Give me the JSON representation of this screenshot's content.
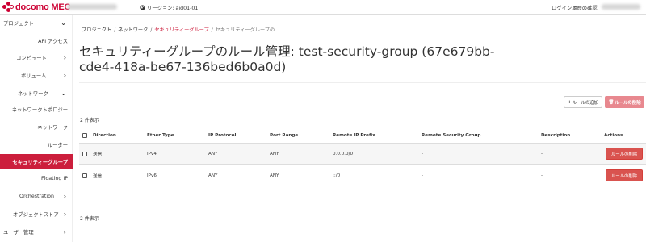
{
  "header": {
    "logo_text": "docomo MEC",
    "region_label": "リージョン: aid01-01",
    "login_history": "ログイン履歴の確認",
    "brand_color": "#cc0033"
  },
  "sidebar": {
    "items": [
      {
        "label": "プロジェクト"
      },
      {
        "label": "API アクセス"
      },
      {
        "label": "コンピュート"
      },
      {
        "label": "ボリューム"
      },
      {
        "label": "ネットワーク"
      },
      {
        "label": "ネットワークトポロジー"
      },
      {
        "label": "ネットワーク"
      },
      {
        "label": "ルーター"
      },
      {
        "label": "セキュリティーグループ"
      },
      {
        "label": "Floating IP"
      },
      {
        "label": "Orchestration"
      },
      {
        "label": "オブジェクトストア"
      },
      {
        "label": "ユーザー管理"
      }
    ],
    "active_index": 8,
    "active_color": "#cc1e3c"
  },
  "breadcrumb": {
    "items": [
      "プロジェクト",
      "ネットワーク",
      "セキュリティーグループ",
      "セキュリティーグループの..."
    ],
    "separator": "/"
  },
  "page": {
    "title": "セキュリティーグループのルール管理: test-security-group (67e679bb-cde4-418a-be67-136bed6b0a0d)"
  },
  "toolbar": {
    "add_rule_label": "ルールの追加",
    "delete_rules_label": "ルールの削除"
  },
  "table": {
    "count_top": "2 件表示",
    "count_bottom": "2 件表示",
    "columns": [
      "Direction",
      "Ether Type",
      "IP Protocol",
      "Port Range",
      "Remote IP Prefix",
      "Remote Security Group",
      "Description",
      "Actions"
    ],
    "rows": [
      {
        "direction": "送信",
        "ether_type": "IPv4",
        "ip_protocol": "ANY",
        "port_range": "ANY",
        "remote_ip_prefix": "0.0.0.0/0",
        "remote_security_group": "-",
        "description": "-",
        "action": "ルールの削除"
      },
      {
        "direction": "送信",
        "ether_type": "IPv6",
        "ip_protocol": "ANY",
        "port_range": "ANY",
        "remote_ip_prefix": "::/0",
        "remote_security_group": "-",
        "description": "-",
        "action": "ルールの削除"
      }
    ]
  }
}
